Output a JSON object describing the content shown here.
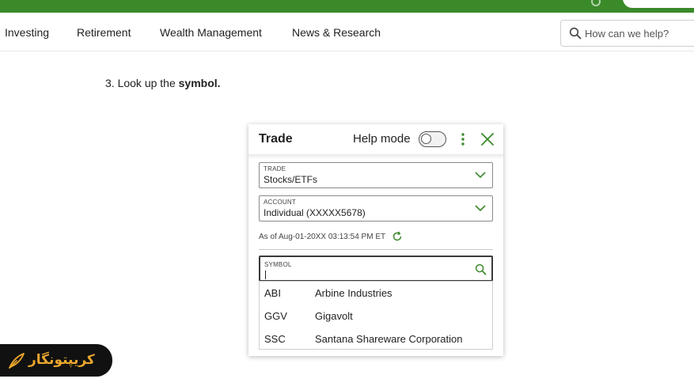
{
  "nav": {
    "items": [
      "Investing",
      "Retirement",
      "Wealth Management",
      "News & Research"
    ],
    "search_placeholder": "How can we help?"
  },
  "instruction": {
    "prefix": "3. Look up the ",
    "bold": "symbol."
  },
  "trade_panel": {
    "title": "Trade",
    "help_mode_label": "Help mode",
    "help_mode_on": false,
    "fields": {
      "trade": {
        "label": "TRADE",
        "value": "Stocks/ETFs"
      },
      "account": {
        "label": "ACCOUNT",
        "value": "Individual (XXXXX5678)"
      }
    },
    "as_of": "As of Aug-01-20XX 03:13:54 PM ET",
    "symbol": {
      "label": "SYMBOL",
      "value": ""
    },
    "results": [
      {
        "ticker": "ABI",
        "name": "Arbine Industries"
      },
      {
        "ticker": "GGV",
        "name": "Gigavolt"
      },
      {
        "ticker": "SSC",
        "name": "Santana Shareware Corporation"
      }
    ]
  },
  "badge": {
    "text": "کریپتونگار"
  },
  "colors": {
    "brand_green": "#3a8a2a",
    "accent_green": "#3a8a2a",
    "badge_bg": "#111111",
    "badge_text": "#e9a62c"
  }
}
